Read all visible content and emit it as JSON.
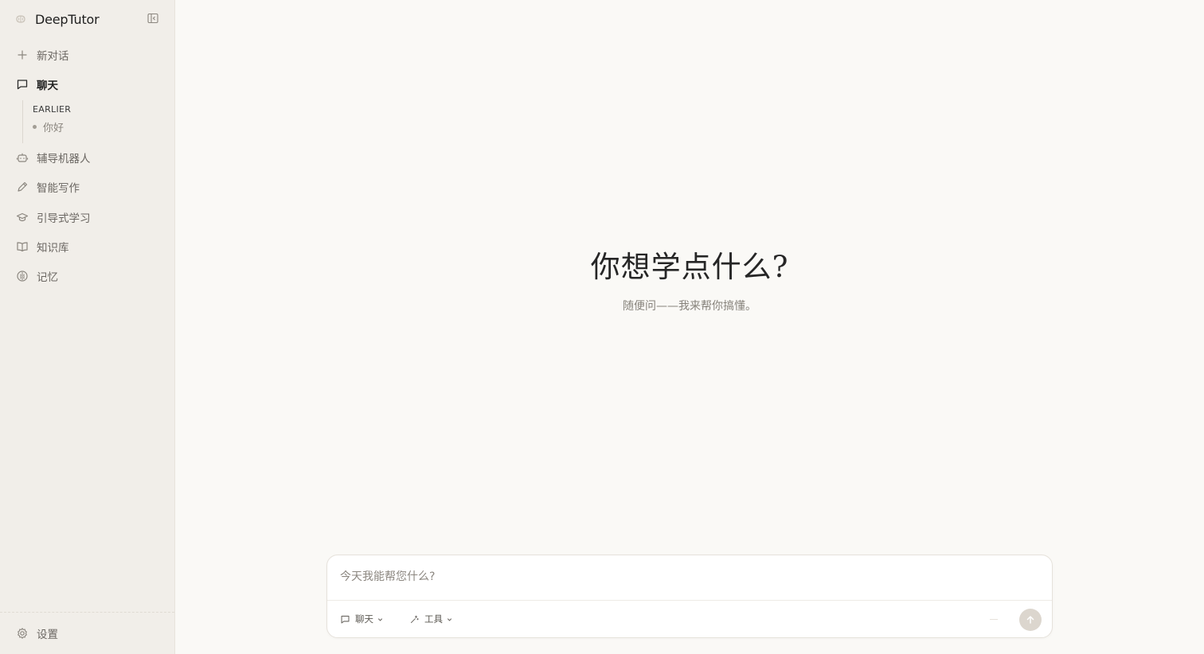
{
  "app": {
    "name": "DeepTutor"
  },
  "sidebar": {
    "new_chat": "新对话",
    "chat": "聊天",
    "history": {
      "group": "EARLIER",
      "items": [
        "你好"
      ]
    },
    "items": [
      "辅导机器人",
      "智能写作",
      "引导式学习",
      "知识库",
      "记忆"
    ],
    "settings": "设置"
  },
  "main": {
    "title": "你想学点什么?",
    "subtitle": "随便问——我来帮你搞懂。"
  },
  "composer": {
    "placeholder": "今天我能帮您什么?",
    "mode_label": "聊天",
    "tools_label": "工具"
  },
  "icons": {
    "logo": "brain-logo-icon",
    "collapse": "sidebar-collapse-icon",
    "new_chat": "plus-icon",
    "chat": "message-square-icon",
    "tutor_bot": "robot-icon",
    "writing": "pencil-icon",
    "guided_learning": "graduation-cap-icon",
    "knowledge_base": "book-open-icon",
    "memory": "brain-icon",
    "settings": "gear-icon",
    "send": "arrow-up-icon"
  },
  "colors": {
    "sidebar_bg": "#f1eee9",
    "main_bg": "#faf9f6",
    "send_bg": "#dcd6ce"
  }
}
